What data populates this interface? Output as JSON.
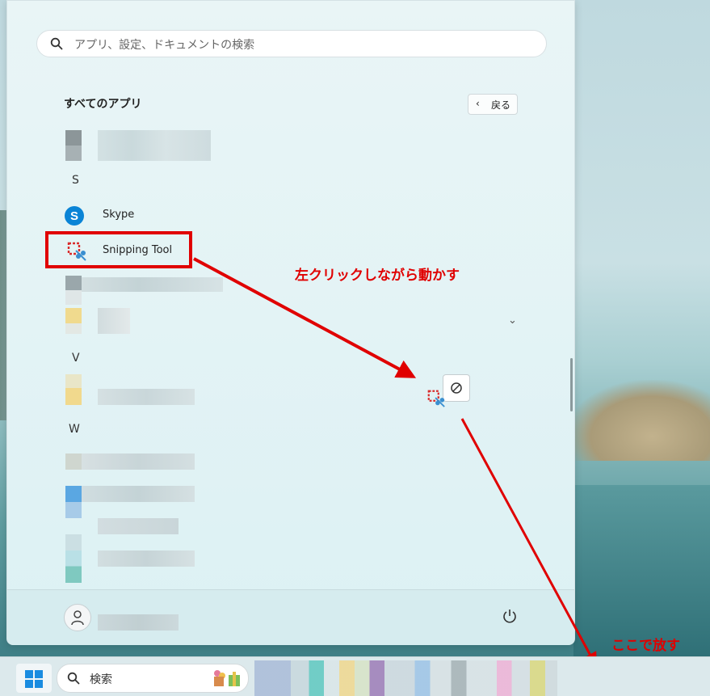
{
  "start_menu": {
    "search_placeholder": "アプリ、設定、ドキュメントの検索",
    "all_apps_title": "すべてのアプリ",
    "back_label": "戻る",
    "back_icon": "chevron-left-icon",
    "letters": {
      "s": "S",
      "v": "V",
      "w": "W"
    },
    "apps": {
      "skype": "Skype",
      "snipping": "Snipping Tool"
    },
    "power_icon": "power-icon",
    "avatar_icon": "user-icon"
  },
  "annotations": {
    "drag_instruction": "左クリックしながら動かす",
    "drop_instruction": "ここで放す",
    "color": "#e00000"
  },
  "taskbar": {
    "search_label": "検索",
    "start_icon": "windows-logo-icon"
  },
  "colors": {
    "skype_blue": "#0a84d6",
    "accent_red": "#e00000"
  }
}
